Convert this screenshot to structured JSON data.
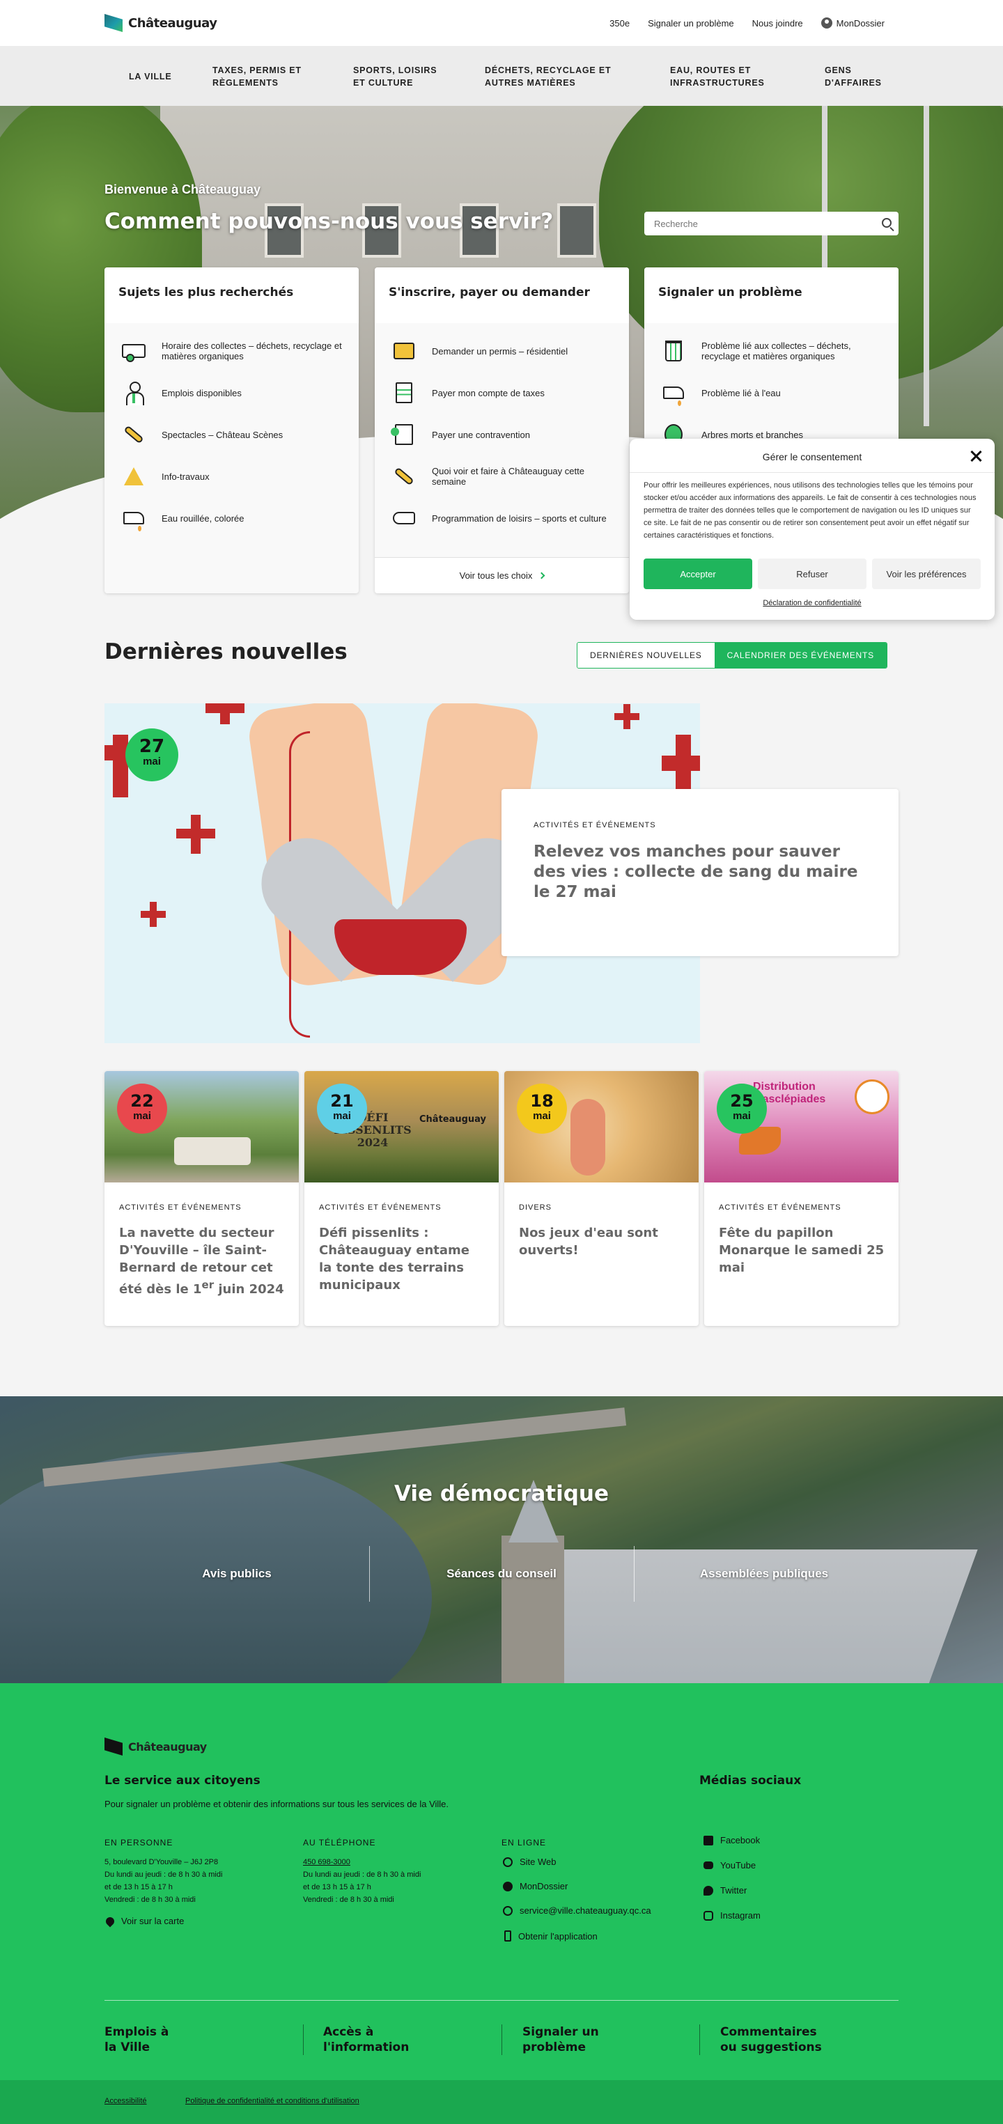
{
  "header": {
    "logo_text": "Châteauguay",
    "links": [
      "350e",
      "Signaler un problème",
      "Nous joindre",
      "MonDossier"
    ]
  },
  "nav": {
    "items": [
      "LA VILLE",
      "TAXES, PERMIS ET RÈGLEMENTS",
      "SPORTS, LOISIRS ET CULTURE",
      "DÉCHETS, RECYCLAGE ET AUTRES MATIÈRES",
      "EAU, ROUTES ET INFRASTRUCTURES",
      "GENS D'AFFAIRES"
    ]
  },
  "hero": {
    "welcome": "Bienvenue à Châteauguay",
    "title": "Comment pouvons-nous vous servir?",
    "search_placeholder": "Recherche"
  },
  "cards": [
    {
      "title": "Sujets les plus recherchés",
      "items": [
        {
          "icon": "truck-icon",
          "label": "Horaire des collectes – déchets, recyclage et matières organiques"
        },
        {
          "icon": "employee-icon",
          "label": "Emplois disponibles"
        },
        {
          "icon": "microphone-icon",
          "label": "Spectacles – Château Scènes"
        },
        {
          "icon": "warning-icon",
          "label": "Info-travaux"
        },
        {
          "icon": "faucet-icon",
          "label": "Eau rouillée, colorée"
        }
      ]
    },
    {
      "title": "S'inscrire, payer ou demander",
      "items": [
        {
          "icon": "permit-card-icon",
          "label": "Demander un permis – résidentiel"
        },
        {
          "icon": "tax-document-icon",
          "label": "Payer mon compte de taxes"
        },
        {
          "icon": "ticket-icon",
          "label": "Payer une contravention"
        },
        {
          "icon": "microphone-icon",
          "label": "Quoi voir et faire à Châteauguay cette semaine"
        },
        {
          "icon": "hand-icon",
          "label": "Programmation de loisirs – sports et culture"
        }
      ],
      "footer": "Voir tous les choix"
    },
    {
      "title": "Signaler un problème",
      "items": [
        {
          "icon": "bin-icon",
          "label": "Problème lié aux collectes – déchets, recyclage et matières organiques"
        },
        {
          "icon": "faucet-icon",
          "label": "Problème lié à l'eau"
        },
        {
          "icon": "tree-icon",
          "label": "Arbres morts et branches"
        }
      ]
    }
  ],
  "cookie": {
    "title": "Gérer le consentement",
    "text": "Pour offrir les meilleures expériences, nous utilisons des technologies telles que les témoins pour stocker et/ou accéder aux informations des appareils. Le fait de consentir à ces technologies nous permettra de traiter des données telles que le comportement de navigation ou les ID uniques sur ce site. Le fait de ne pas consentir ou de retirer son consentement peut avoir un effet négatif sur certaines caractéristiques et fonctions.",
    "accept": "Accepter",
    "refuse": "Refuser",
    "prefs": "Voir les préférences",
    "policy": "Déclaration de confidentialité"
  },
  "news": {
    "title": "Dernières nouvelles",
    "tab_news": "DERNIÈRES NOUVELLES",
    "tab_calendar": "CALENDRIER DES ÉVÉNEMENTS",
    "featured": {
      "day": "27",
      "month": "mai",
      "category": "ACTIVITÉS ET ÉVÉNEMENTS",
      "headline": "Relevez vos manches pour sauver des vies : collecte de sang du maire le 27 mai"
    },
    "items": [
      {
        "day": "22",
        "month": "mai",
        "category": "ACTIVITÉS ET ÉVÉNEMENTS",
        "headline_a": "La navette du secteur D'Youville – île Saint-Bernard de retour cet été dès le 1",
        "sup": "er",
        "headline_b": " juin 2024",
        "badge_color": "#e8484d"
      },
      {
        "day": "21",
        "month": "mai",
        "category": "ACTIVITÉS ET ÉVÉNEMENTS",
        "headline_a": "Défi pissenlits : Châteauguay entame la tonte des terrains municipaux",
        "sup": "",
        "headline_b": "",
        "badge_color": "#5fcfe6"
      },
      {
        "day": "18",
        "month": "mai",
        "category": "DIVERS",
        "headline_a": "Nos jeux d'eau sont ouverts!",
        "sup": "",
        "headline_b": "",
        "badge_color": "#f3c81c"
      },
      {
        "day": "25",
        "month": "mai",
        "category": "ACTIVITÉS ET ÉVÉNEMENTS",
        "headline_a": "Fête du papillon Monarque le samedi 25 mai",
        "sup": "",
        "headline_b": "",
        "badge_color": "#27c45f"
      }
    ],
    "img2_text": "DÉFI PISSENLITS 2024",
    "img2_logo": "Châteauguay",
    "img4_text": "Distribution d'asclépiades"
  },
  "democratic": {
    "title": "Vie démocratique",
    "links": [
      "Avis publics",
      "Séances du conseil",
      "Assemblées publiques"
    ]
  },
  "footer": {
    "logo_text": "Châteauguay",
    "service_title": "Le service aux citoyens",
    "service_text": "Pour signaler un problème et obtenir des informations sur tous les services de la Ville.",
    "in_person_label": "EN PERSONNE",
    "in_person_lines": [
      "5, boulevard D'Youville – J6J 2P8",
      "Du lundi au jeudi : de 8 h 30 à midi",
      "et de 13 h 15 à 17 h",
      "Vendredi : de 8 h 30 à midi"
    ],
    "map_link": "Voir sur la carte",
    "phone_label": "AU TÉLÉPHONE",
    "phone": "450 698-3000",
    "phone_lines": [
      "Du lundi au jeudi : de 8 h 30 à midi",
      "et de 13 h 15 à 17 h",
      "Vendredi : de 8 h 30 à midi"
    ],
    "online_label": "EN LIGNE",
    "online_links": [
      "Site Web",
      "MonDossier",
      "service@ville.chateauguay.qc.ca",
      "Obtenir l'application"
    ],
    "social_title": "Médias sociaux",
    "social_links": [
      "Facebook",
      "YouTube",
      "Twitter",
      "Instagram"
    ],
    "bottom_links": [
      "Emplois à la Ville",
      "Accès à l'information",
      "Signaler un problème",
      "Commentaires ou suggestions"
    ],
    "legal": [
      "Accessibilité",
      "Politique de confidentialité et conditions d'utilisation"
    ]
  }
}
